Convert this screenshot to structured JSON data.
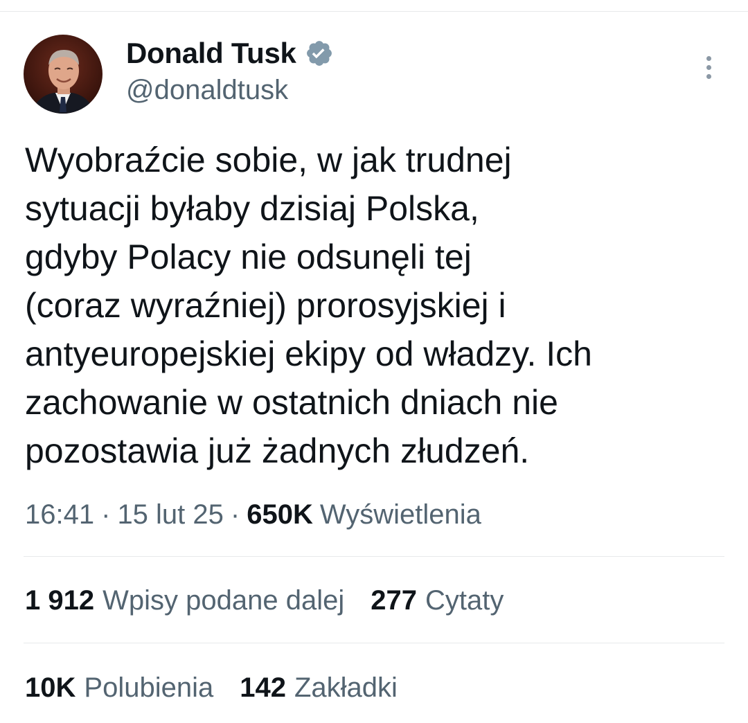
{
  "author": {
    "display_name": "Donald Tusk",
    "handle": "@donaldtusk",
    "verified": true,
    "verified_color": "#829aab"
  },
  "tweet": {
    "text": "Wyobraźcie sobie, w jak trudnej\nsytuacji byłaby dzisiaj Polska,\ngdyby Polacy nie odsunęli tej\n(coraz wyraźniej) prorosyjskiej i\nantyeuropejskiej ekipy od władzy. Ich\nzachowanie w ostatnich dniach nie\npozostawia już żadnych złudzeń."
  },
  "meta": {
    "time": "16:41",
    "separator": "·",
    "date": "15 lut 25",
    "views_count": "650K",
    "views_label": "Wyświetlenia"
  },
  "stats": {
    "reposts": {
      "count": "1 912",
      "label": "Wpisy podane dalej"
    },
    "quotes": {
      "count": "277",
      "label": "Cytaty"
    },
    "likes": {
      "count": "10K",
      "label": "Polubienia"
    },
    "bookmarks": {
      "count": "142",
      "label": "Zakładki"
    }
  },
  "icons": {
    "more": "more-vertical-icon",
    "verified": "verified-badge-icon"
  },
  "colors": {
    "text_primary": "#0f1419",
    "text_secondary": "#536471",
    "divider": "#e7e9ea"
  }
}
